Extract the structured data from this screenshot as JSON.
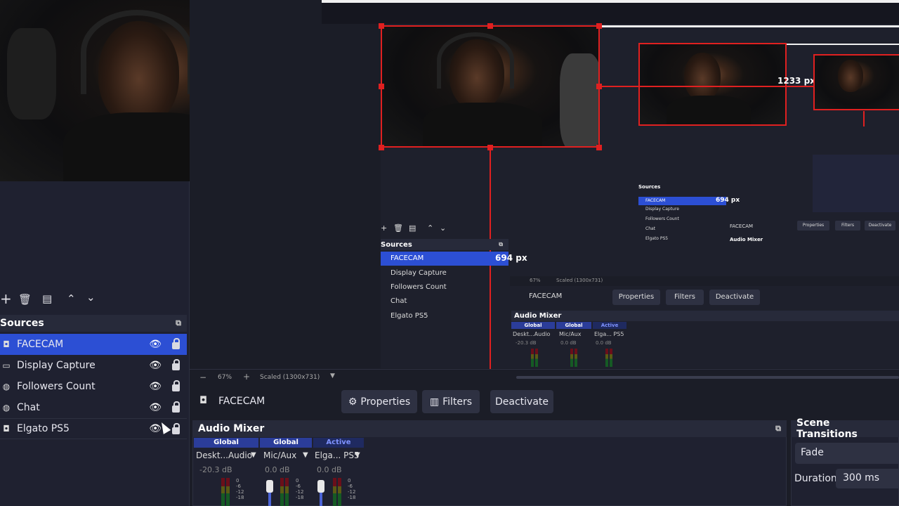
{
  "sources": {
    "title": "Sources",
    "items": [
      {
        "label": "FACECAM",
        "icon": "camera-icon",
        "selected": true
      },
      {
        "label": "Display Capture",
        "icon": "monitor-icon",
        "selected": false
      },
      {
        "label": "Followers Count",
        "icon": "globe-icon",
        "selected": false
      },
      {
        "label": "Chat",
        "icon": "globe-icon",
        "selected": false
      },
      {
        "label": "Elgato PS5",
        "icon": "camera-icon",
        "selected": false
      }
    ]
  },
  "status_bar": {
    "zoom": "67%",
    "scale": "Scaled (1300x731)"
  },
  "context_bar": {
    "source": "FACECAM",
    "properties_label": "Properties",
    "filters_label": "Filters",
    "deactivate_label": "Deactivate"
  },
  "audio_mixer": {
    "title": "Audio Mixer",
    "channels": [
      {
        "badge": "Global",
        "name": "Deskt...Audio",
        "db": "-20.3 dB",
        "active": false
      },
      {
        "badge": "Global",
        "name": "Mic/Aux",
        "db": "0.0 dB",
        "active": false
      },
      {
        "badge": "Active",
        "name": "Elga... PS5",
        "db": "0.0 dB",
        "active": true
      }
    ],
    "ticks": [
      "0",
      "-6",
      "-12",
      "-18"
    ]
  },
  "mid_mixer": {
    "channels": [
      {
        "badge": "Global",
        "name": "Deskt...Audio",
        "db": "-20.3 dB"
      },
      {
        "badge": "Global",
        "name": "Mic/Aux",
        "db": "0.0 dB"
      },
      {
        "badge": "Active",
        "name": "Elga... PS5",
        "db": "0.0 dB"
      }
    ]
  },
  "scene_transitions": {
    "title": "Scene Transitions",
    "transition": "Fade",
    "duration_label": "Duration",
    "duration": "300 ms"
  },
  "measurements": {
    "width_label": "1233 px",
    "height_label": "694 px",
    "height_label_small": "694 px"
  },
  "colors": {
    "accent": "#2c4fd4",
    "selection": "#e02020",
    "dock": "#1f2130"
  }
}
